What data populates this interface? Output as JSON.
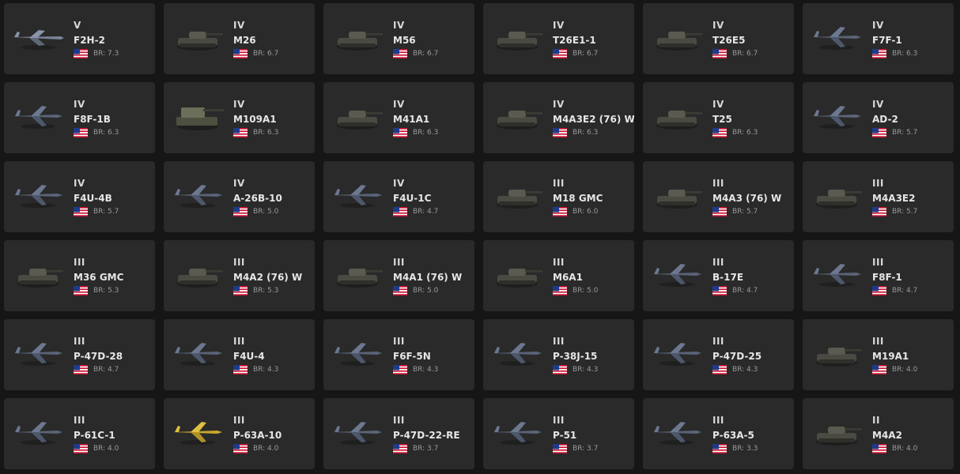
{
  "labels": {
    "br_prefix": "BR:"
  },
  "colors": {
    "card_bg": "#2a2a2a",
    "page_bg": "#161616",
    "text": "#e6e6e6",
    "br_text": "#9a9a9a"
  },
  "vehicles": [
    {
      "rank": "V",
      "name": "F2H-2",
      "br": "7.3",
      "kind": "jet",
      "country": "us-flag-icon"
    },
    {
      "rank": "IV",
      "name": "M26",
      "br": "6.7",
      "kind": "tank"
    },
    {
      "rank": "IV",
      "name": "M56",
      "br": "6.7",
      "kind": "tank"
    },
    {
      "rank": "IV",
      "name": "T26E1-1",
      "br": "6.7",
      "kind": "tank"
    },
    {
      "rank": "IV",
      "name": "T26E5",
      "br": "6.7",
      "kind": "tank"
    },
    {
      "rank": "IV",
      "name": "F7F-1",
      "br": "6.3",
      "kind": "plane"
    },
    {
      "rank": "IV",
      "name": "F8F-1B",
      "br": "6.3",
      "kind": "plane"
    },
    {
      "rank": "IV",
      "name": "M109A1",
      "br": "6.3",
      "kind": "spg"
    },
    {
      "rank": "IV",
      "name": "M41A1",
      "br": "6.3",
      "kind": "tank"
    },
    {
      "rank": "IV",
      "name": "M4A3E2 (76) W",
      "br": "6.3",
      "kind": "tank"
    },
    {
      "rank": "IV",
      "name": "T25",
      "br": "6.3",
      "kind": "tank"
    },
    {
      "rank": "IV",
      "name": "AD-2",
      "br": "5.7",
      "kind": "plane"
    },
    {
      "rank": "IV",
      "name": "F4U-4B",
      "br": "5.7",
      "kind": "plane"
    },
    {
      "rank": "IV",
      "name": "A-26B-10",
      "br": "5.0",
      "kind": "plane"
    },
    {
      "rank": "IV",
      "name": "F4U-1C",
      "br": "4.7",
      "kind": "plane"
    },
    {
      "rank": "III",
      "name": "M18 GMC",
      "br": "6.0",
      "kind": "tank"
    },
    {
      "rank": "III",
      "name": "M4A3 (76) W",
      "br": "5.7",
      "kind": "tank"
    },
    {
      "rank": "III",
      "name": "M4A3E2",
      "br": "5.7",
      "kind": "tank"
    },
    {
      "rank": "III",
      "name": "M36 GMC",
      "br": "5.3",
      "kind": "tank"
    },
    {
      "rank": "III",
      "name": "M4A2 (76) W",
      "br": "5.3",
      "kind": "tank"
    },
    {
      "rank": "III",
      "name": "M4A1 (76) W",
      "br": "5.0",
      "kind": "tank"
    },
    {
      "rank": "III",
      "name": "M6A1",
      "br": "5.0",
      "kind": "tank"
    },
    {
      "rank": "III",
      "name": "B-17E",
      "br": "4.7",
      "kind": "plane"
    },
    {
      "rank": "III",
      "name": "F8F-1",
      "br": "4.7",
      "kind": "plane"
    },
    {
      "rank": "III",
      "name": "P-47D-28",
      "br": "4.7",
      "kind": "plane"
    },
    {
      "rank": "III",
      "name": "F4U-4",
      "br": "4.3",
      "kind": "plane"
    },
    {
      "rank": "III",
      "name": "F6F-5N",
      "br": "4.3",
      "kind": "plane"
    },
    {
      "rank": "III",
      "name": "P-38J-15",
      "br": "4.3",
      "kind": "plane"
    },
    {
      "rank": "III",
      "name": "P-47D-25",
      "br": "4.3",
      "kind": "plane"
    },
    {
      "rank": "III",
      "name": "M19A1",
      "br": "4.0",
      "kind": "tank"
    },
    {
      "rank": "III",
      "name": "P-61C-1",
      "br": "4.0",
      "kind": "plane"
    },
    {
      "rank": "III",
      "name": "P-63A-10",
      "br": "4.0",
      "kind": "plane-yellow"
    },
    {
      "rank": "III",
      "name": "P-47D-22-RE",
      "br": "3.7",
      "kind": "plane"
    },
    {
      "rank": "III",
      "name": "P-51",
      "br": "3.7",
      "kind": "plane"
    },
    {
      "rank": "III",
      "name": "P-63A-5",
      "br": "3.3",
      "kind": "plane"
    },
    {
      "rank": "II",
      "name": "M4A2",
      "br": "4.0",
      "kind": "tank"
    }
  ]
}
